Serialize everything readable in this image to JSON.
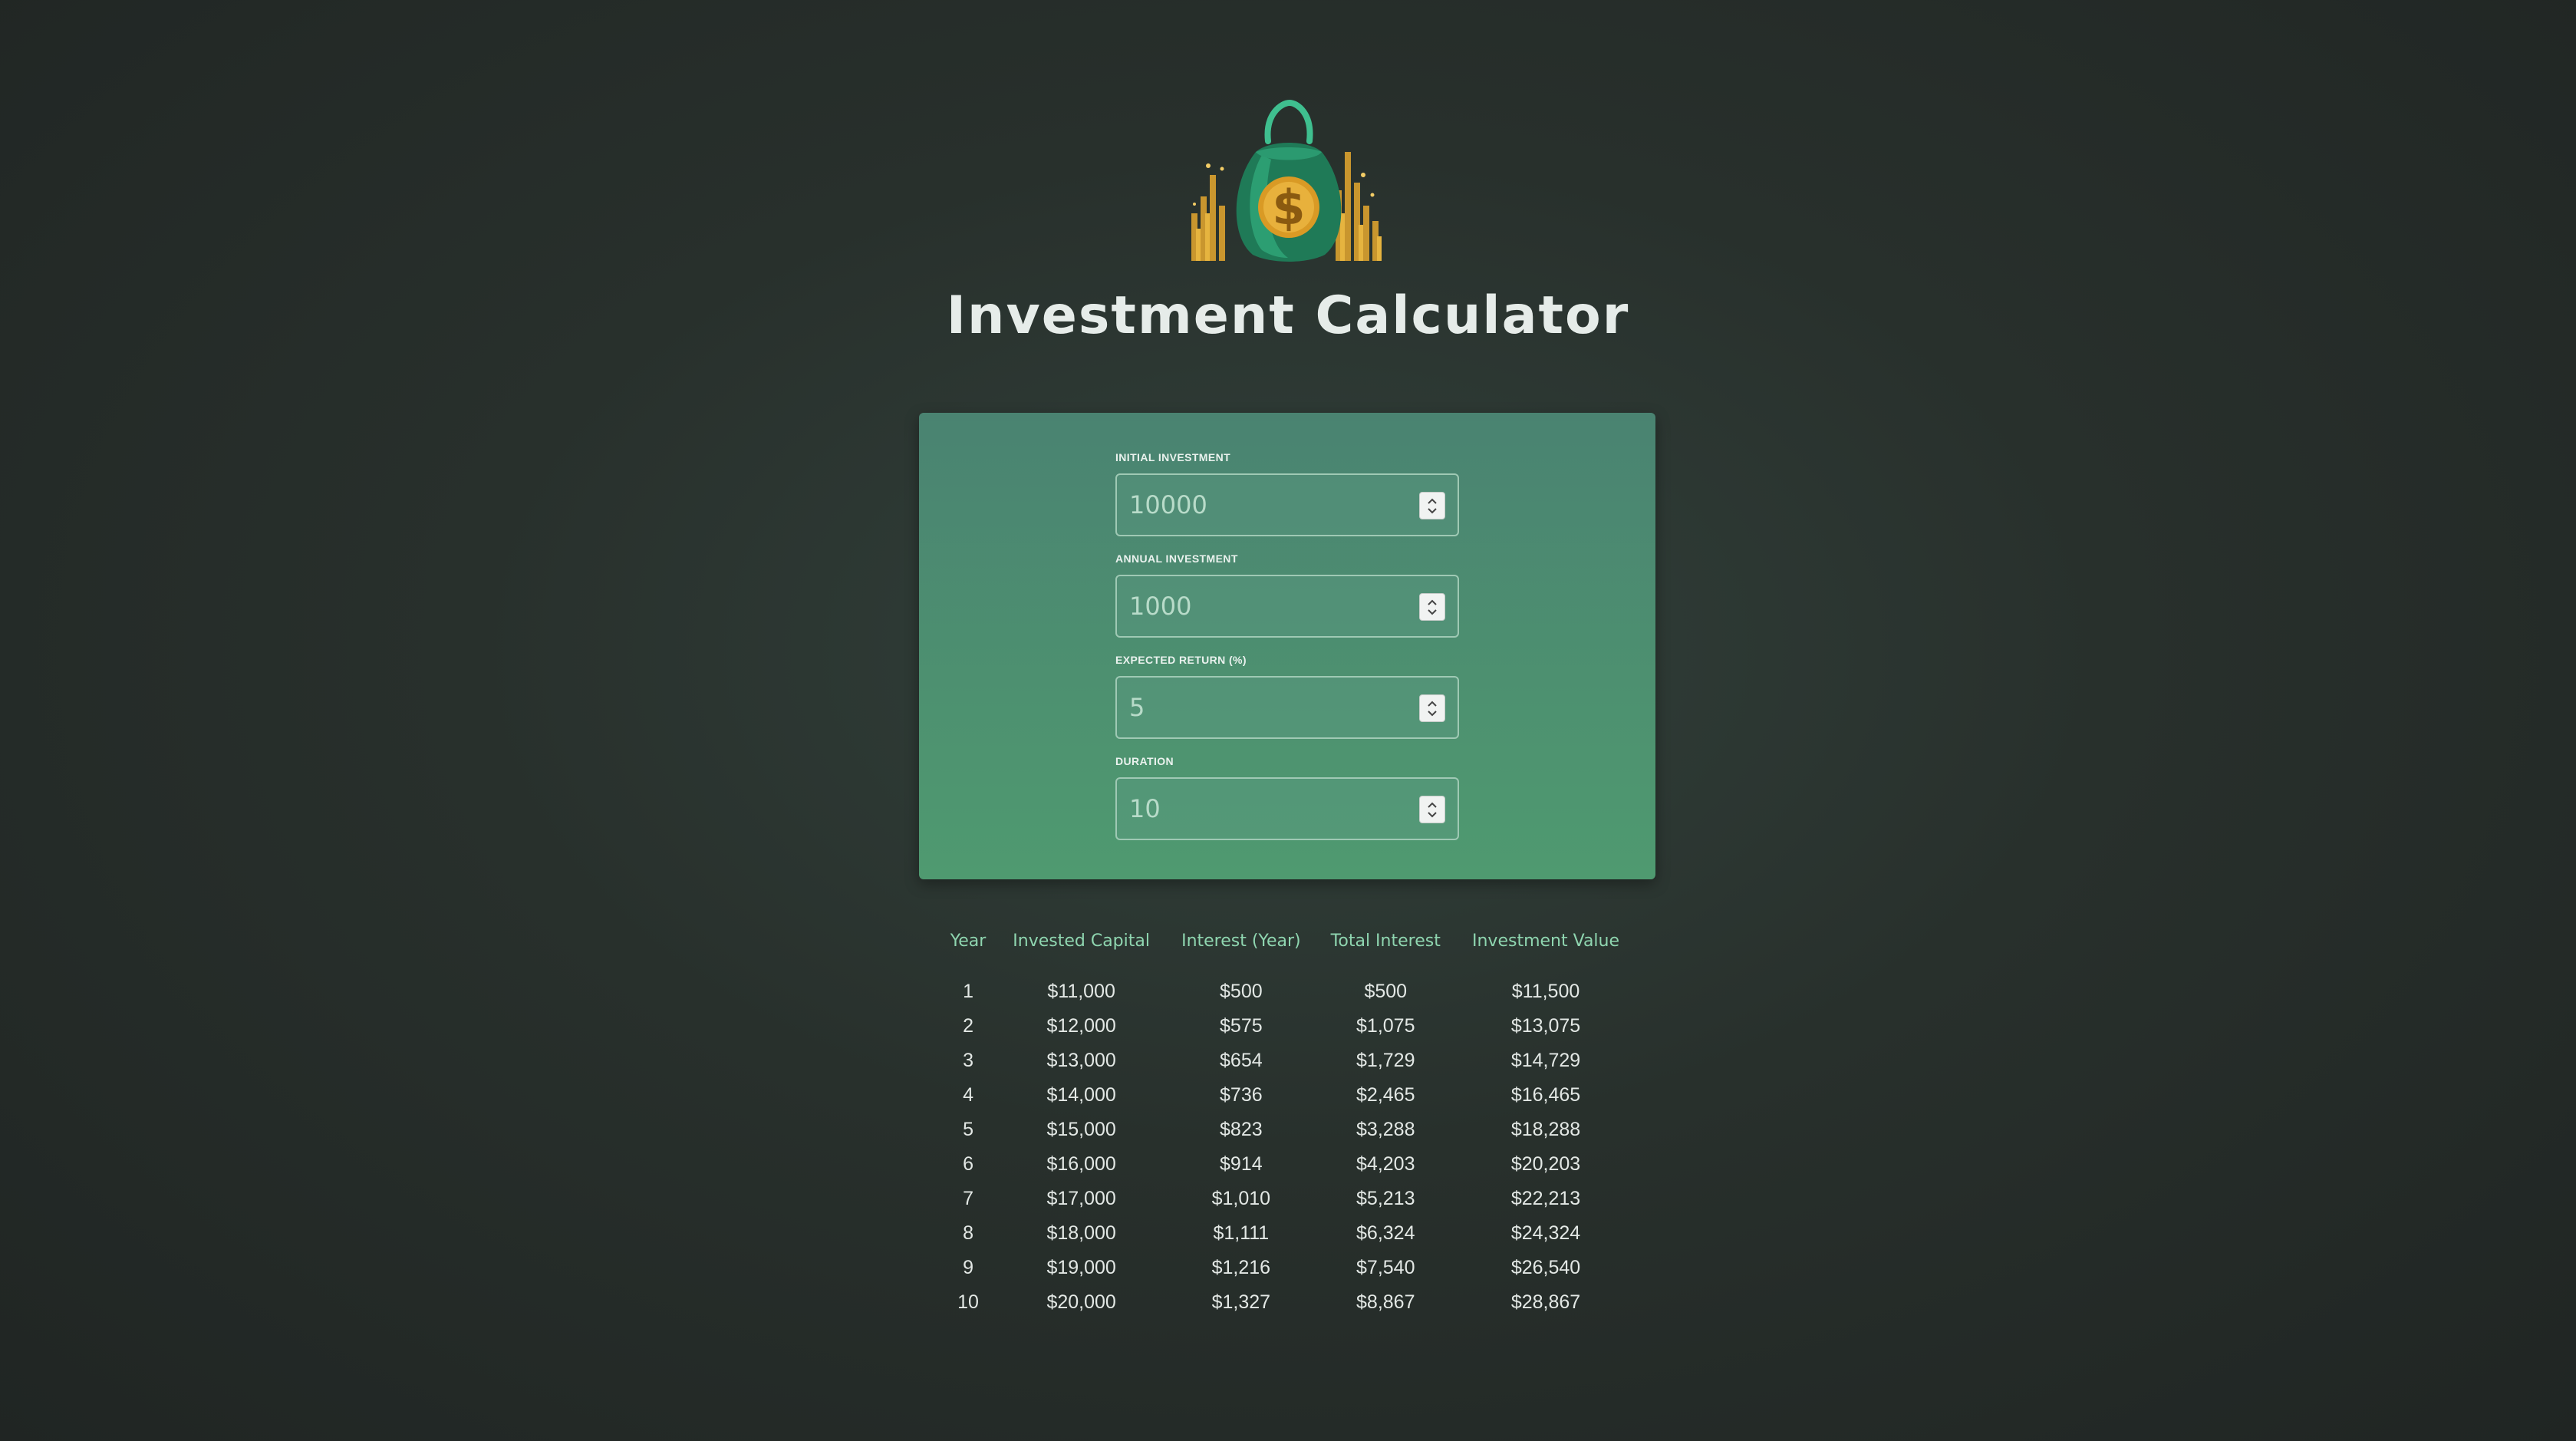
{
  "app": {
    "title": "Investment Calculator",
    "logo_icon": "money-bag-icon"
  },
  "form": {
    "fields": [
      {
        "label": "INITIAL INVESTMENT",
        "value": "10000"
      },
      {
        "label": "ANNUAL INVESTMENT",
        "value": "1000"
      },
      {
        "label": "EXPECTED RETURN (%)",
        "value": "5"
      },
      {
        "label": "DURATION",
        "value": "10"
      }
    ]
  },
  "table": {
    "headers": [
      "Year",
      "Invested Capital",
      "Interest (Year)",
      "Total Interest",
      "Investment Value"
    ],
    "rows": [
      [
        "1",
        "$11,000",
        "$500",
        "$500",
        "$11,500"
      ],
      [
        "2",
        "$12,000",
        "$575",
        "$1,075",
        "$13,075"
      ],
      [
        "3",
        "$13,000",
        "$654",
        "$1,729",
        "$14,729"
      ],
      [
        "4",
        "$14,000",
        "$736",
        "$2,465",
        "$16,465"
      ],
      [
        "5",
        "$15,000",
        "$823",
        "$3,288",
        "$18,288"
      ],
      [
        "6",
        "$16,000",
        "$914",
        "$4,203",
        "$20,203"
      ],
      [
        "7",
        "$17,000",
        "$1,010",
        "$5,213",
        "$22,213"
      ],
      [
        "8",
        "$18,000",
        "$1,111",
        "$6,324",
        "$24,324"
      ],
      [
        "9",
        "$19,000",
        "$1,216",
        "$7,540",
        "$26,540"
      ],
      [
        "10",
        "$20,000",
        "$1,327",
        "$8,867",
        "$28,867"
      ]
    ]
  },
  "colors": {
    "background": "#28302c",
    "card_top": "#4a8371",
    "card_bottom": "#4f9a70",
    "header_text": "#8fd6b0",
    "accent_gold": "#d9a233"
  }
}
